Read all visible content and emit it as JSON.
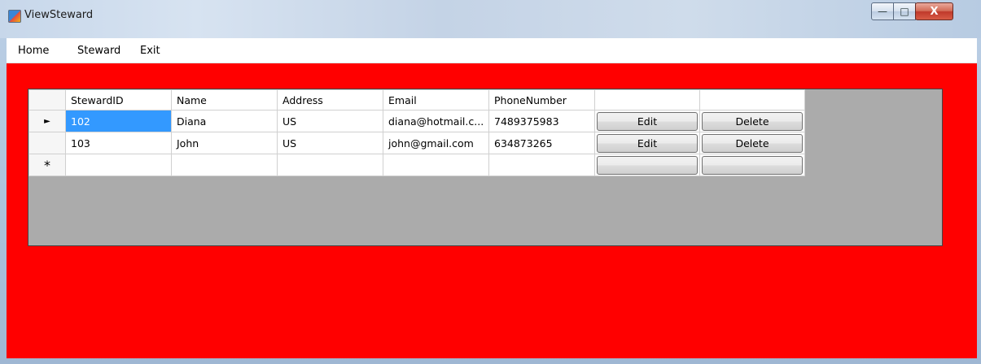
{
  "window": {
    "title": "ViewSteward",
    "app_icon": "app-window-icon"
  },
  "caption_buttons": {
    "minimize": "—",
    "maximize": "□",
    "close": "X"
  },
  "menu": [
    {
      "label": "Home"
    },
    {
      "label": "Steward"
    },
    {
      "label": "Exit"
    }
  ],
  "grid": {
    "columns": [
      "StewardID",
      "Name",
      "Address",
      "Email",
      "PhoneNumber",
      "",
      ""
    ],
    "rows": [
      {
        "indicator": "►",
        "steward_id": "102",
        "name": "Diana",
        "address": "US",
        "email": "diana@hotmail.c...",
        "phone": "7489375983",
        "edit": "Edit",
        "delete": "Delete"
      },
      {
        "indicator": "",
        "steward_id": "103",
        "name": "John",
        "address": "US",
        "email": "john@gmail.com",
        "phone": "634873265",
        "edit": "Edit",
        "delete": "Delete"
      }
    ],
    "new_row": {
      "indicator": "*",
      "edit": "",
      "delete": ""
    }
  },
  "colors": {
    "form_background": "#ff0000",
    "grid_background": "#ababab",
    "selection": "#3399ff"
  }
}
